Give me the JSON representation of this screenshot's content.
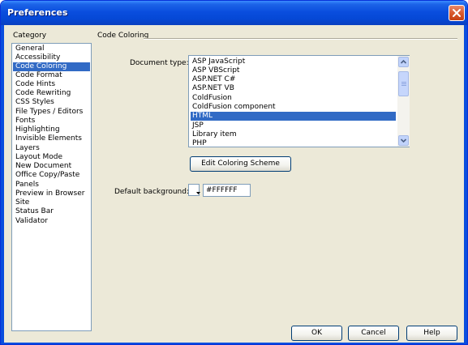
{
  "window": {
    "title": "Preferences"
  },
  "sidebar": {
    "heading": "Category",
    "items": [
      {
        "label": "General"
      },
      {
        "label": "Accessibility"
      },
      {
        "label": "Code Coloring",
        "selected": true
      },
      {
        "label": "Code Format"
      },
      {
        "label": "Code Hints"
      },
      {
        "label": "Code Rewriting"
      },
      {
        "label": "CSS Styles"
      },
      {
        "label": "File Types / Editors"
      },
      {
        "label": "Fonts"
      },
      {
        "label": "Highlighting"
      },
      {
        "label": "Invisible Elements"
      },
      {
        "label": "Layers"
      },
      {
        "label": "Layout Mode"
      },
      {
        "label": "New Document"
      },
      {
        "label": "Office Copy/Paste"
      },
      {
        "label": "Panels"
      },
      {
        "label": "Preview in Browser"
      },
      {
        "label": "Site"
      },
      {
        "label": "Status Bar"
      },
      {
        "label": "Validator"
      }
    ]
  },
  "panel": {
    "section_title": "Code Coloring",
    "document_type_label": "Document type:",
    "document_types": [
      {
        "label": "ASP JavaScript"
      },
      {
        "label": "ASP VBScript"
      },
      {
        "label": "ASP.NET C#"
      },
      {
        "label": "ASP.NET VB"
      },
      {
        "label": "ColdFusion"
      },
      {
        "label": "ColdFusion component"
      },
      {
        "label": "HTML",
        "selected": true
      },
      {
        "label": "JSP"
      },
      {
        "label": "Library item"
      },
      {
        "label": "PHP"
      }
    ],
    "edit_button": "Edit Coloring Scheme",
    "default_bg_label": "Default background:",
    "default_bg_value": "#FFFFFF"
  },
  "footer": {
    "ok_label": "OK",
    "cancel_label": "Cancel",
    "help_label": "Help"
  },
  "colors": {
    "titlebar": "#0a4ede",
    "selection": "#316ac5",
    "dialog_bg": "#ece9d8",
    "close_button": "#d85a30"
  },
  "icons": {
    "close": "close-icon",
    "scroll_up": "chevron-up-icon",
    "scroll_down": "chevron-down-icon",
    "swatch_dropdown": "dropdown-arrow-icon"
  }
}
